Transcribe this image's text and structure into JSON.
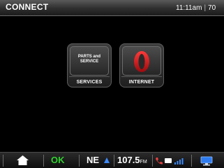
{
  "header": {
    "title": "CONNECT",
    "time": "11:11am",
    "separator": "|",
    "temp": "70"
  },
  "tiles": [
    {
      "icon_text": "PARTS and\nSERVICE",
      "label": "SERVICES",
      "icon": "parts-service-icon"
    },
    {
      "label": "INTERNET",
      "icon": "opera-browser-icon"
    }
  ],
  "footer": {
    "status": "OK",
    "heading": "NE",
    "frequency": "107.5",
    "band": "FM",
    "icons": [
      "home-icon",
      "compass-arrow-icon",
      "phone-icon",
      "message-icon",
      "signal-icon",
      "screen-icon"
    ]
  },
  "colors": {
    "ok_green": "#2fd12f",
    "compass_blue": "#3d8bff",
    "opera_red": "#d2141a",
    "screen_blue": "#2f7cf0"
  }
}
